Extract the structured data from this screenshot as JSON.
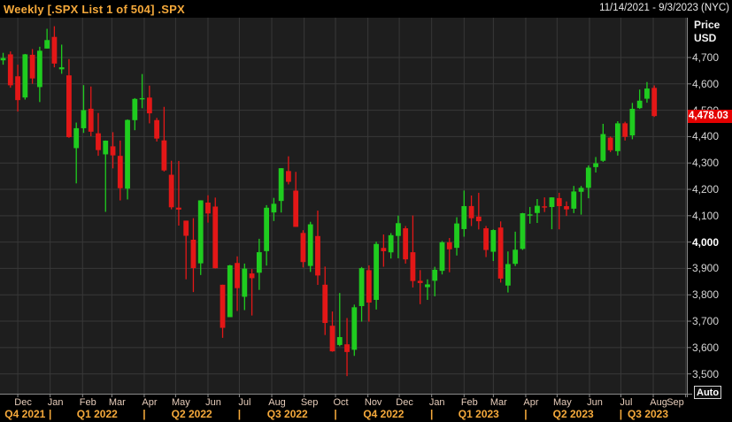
{
  "header": {
    "title": "Weekly [.SPX List 1 of 504] .SPX",
    "date_range": "11/14/2021 - 9/3/2023 (NYC)"
  },
  "price_axis": {
    "title_line1": "Price",
    "title_line2": "USD",
    "ticks": [
      4700,
      4600,
      4500,
      4400,
      4300,
      4200,
      4100,
      4000,
      3900,
      3800,
      3700,
      3600,
      3500
    ],
    "bold_tick": 4000,
    "last_price": "4,478.03",
    "auto_label": "Auto"
  },
  "time_axis": {
    "total_days": 658,
    "months": [
      {
        "label": "Dec",
        "day": 17
      },
      {
        "label": "Jan",
        "day": 48
      },
      {
        "label": "Feb",
        "day": 79
      },
      {
        "label": "Mar",
        "day": 107
      },
      {
        "label": "Apr",
        "day": 138
      },
      {
        "label": "May",
        "day": 168
      },
      {
        "label": "Jun",
        "day": 199
      },
      {
        "label": "Jul",
        "day": 229
      },
      {
        "label": "Aug",
        "day": 260
      },
      {
        "label": "Sep",
        "day": 291
      },
      {
        "label": "Oct",
        "day": 321
      },
      {
        "label": "Nov",
        "day": 352
      },
      {
        "label": "Dec",
        "day": 382
      },
      {
        "label": "Jan",
        "day": 413
      },
      {
        "label": "Feb",
        "day": 444
      },
      {
        "label": "Mar",
        "day": 472
      },
      {
        "label": "Apr",
        "day": 503
      },
      {
        "label": "May",
        "day": 533
      },
      {
        "label": "Jun",
        "day": 564
      },
      {
        "label": "Jul",
        "day": 594
      },
      {
        "label": "Aug",
        "day": 625
      },
      {
        "label": "Sep",
        "day": 656
      }
    ],
    "quarters": [
      {
        "label": "Q4 2021",
        "start": 0,
        "end": 48
      },
      {
        "label": "Q1 2022",
        "start": 48,
        "end": 138
      },
      {
        "label": "Q2 2022",
        "start": 138,
        "end": 229
      },
      {
        "label": "Q3 2022",
        "start": 229,
        "end": 321
      },
      {
        "label": "Q4 2022",
        "start": 321,
        "end": 413
      },
      {
        "label": "Q1 2023",
        "start": 413,
        "end": 503
      },
      {
        "label": "Q2 2023",
        "start": 503,
        "end": 594
      },
      {
        "label": "Q3 2023",
        "start": 594,
        "end": 658
      }
    ]
  },
  "colors": {
    "up_candle": "#1fcc1f",
    "down_candle": "#e31717",
    "badge_bg": "#e30000",
    "accent_amber": "#f5a93b",
    "month_label": "#e7cdbb",
    "plot_bg": "#1e1e1e",
    "gridline": "#383838",
    "axis_line": "#8a8a8a"
  },
  "chart_data": {
    "type": "candlestick",
    "symbol": ".SPX",
    "interval": "weekly",
    "title": "Weekly [.SPX List 1 of 504] .SPX",
    "ylabel": "Price USD",
    "last_close": 4478.03,
    "price_domain": [
      3425,
      4851
    ],
    "axis_ticks": [
      3500,
      3600,
      3700,
      3800,
      3900,
      4000,
      4100,
      4200,
      4300,
      4400,
      4500,
      4600,
      4700
    ],
    "x_range": [
      "2021-11-14",
      "2023-09-03"
    ],
    "grid": "monthly-vertical, 100pt-horizontal",
    "columns": [
      "week_ending",
      "open",
      "high",
      "low",
      "close"
    ],
    "candles": [
      [
        "2021-11-19",
        4689.3,
        4717.75,
        4672.78,
        4697.96
      ],
      [
        "2021-11-26",
        4712.0,
        4723.0,
        4585.43,
        4594.62
      ],
      [
        "2021-12-03",
        4628.75,
        4672.95,
        4495.12,
        4538.43
      ],
      [
        "2021-12-10",
        4548.37,
        4713.57,
        4540.51,
        4712.02
      ],
      [
        "2021-12-17",
        4710.3,
        4731.99,
        4600.22,
        4620.64
      ],
      [
        "2021-12-23",
        4587.9,
        4740.74,
        4531.1,
        4725.79
      ],
      [
        "2021-12-31",
        4733.99,
        4808.93,
        4733.99,
        4766.18
      ],
      [
        "2022-01-07",
        4778.14,
        4818.62,
        4662.74,
        4677.03
      ],
      [
        "2022-01-14",
        4655.34,
        4748.83,
        4638.27,
        4662.85
      ],
      [
        "2022-01-21",
        4632.24,
        4694.0,
        4395.34,
        4397.94
      ],
      [
        "2022-01-28",
        4356.32,
        4453.23,
        4222.62,
        4431.85
      ],
      [
        "2022-02-04",
        4431.79,
        4595.31,
        4414.02,
        4500.53
      ],
      [
        "2022-02-11",
        4505.75,
        4590.03,
        4401.41,
        4418.64
      ],
      [
        "2022-02-18",
        4412.61,
        4489.55,
        4327.22,
        4348.87
      ],
      [
        "2022-02-25",
        4332.74,
        4385.34,
        4114.65,
        4384.65
      ],
      [
        "2022-03-04",
        4363.14,
        4416.78,
        4279.54,
        4328.87
      ],
      [
        "2022-03-11",
        4327.01,
        4385.0,
        4157.87,
        4204.31
      ],
      [
        "2022-03-18",
        4202.75,
        4465.4,
        4161.72,
        4463.12
      ],
      [
        "2022-03-25",
        4462.4,
        4546.03,
        4424.3,
        4543.06
      ],
      [
        "2022-04-01",
        4541.09,
        4637.3,
        4507.57,
        4545.86
      ],
      [
        "2022-04-08",
        4547.97,
        4593.45,
        4450.3,
        4488.28
      ],
      [
        "2022-04-14",
        4462.64,
        4471.03,
        4381.34,
        4392.59
      ],
      [
        "2022-04-22",
        4385.63,
        4512.94,
        4267.62,
        4271.78
      ],
      [
        "2022-04-29",
        4255.34,
        4308.45,
        4124.28,
        4131.93
      ],
      [
        "2022-05-06",
        4130.61,
        4307.66,
        4062.51,
        4123.34
      ],
      [
        "2022-05-13",
        4081.27,
        4081.27,
        3858.87,
        4023.89
      ],
      [
        "2022-05-20",
        4008.91,
        4090.72,
        3810.32,
        3901.36
      ],
      [
        "2022-05-27",
        3919.42,
        4158.49,
        3875.13,
        4158.24
      ],
      [
        "2022-06-03",
        4149.78,
        4177.51,
        4073.85,
        4108.54
      ],
      [
        "2022-06-10",
        4134.72,
        4168.78,
        3900.16,
        3900.86
      ],
      [
        "2022-06-17",
        3838.15,
        3838.48,
        3636.87,
        3674.84
      ],
      [
        "2022-06-24",
        3715.31,
        3913.65,
        3715.31,
        3911.74
      ],
      [
        "2022-07-01",
        3920.76,
        3945.86,
        3738.67,
        3825.33
      ],
      [
        "2022-07-08",
        3792.61,
        3918.5,
        3742.06,
        3899.38
      ],
      [
        "2022-07-15",
        3880.94,
        3897.58,
        3721.56,
        3863.16
      ],
      [
        "2022-07-22",
        3883.79,
        4012.44,
        3818.63,
        3961.63
      ],
      [
        "2022-07-29",
        3965.72,
        4140.15,
        3910.74,
        4130.29
      ],
      [
        "2022-08-05",
        4112.38,
        4167.66,
        4079.81,
        4145.19
      ],
      [
        "2022-08-12",
        4155.93,
        4280.47,
        4112.09,
        4280.15
      ],
      [
        "2022-08-19",
        4269.37,
        4325.28,
        4218.7,
        4228.48
      ],
      [
        "2022-08-26",
        4195.08,
        4266.31,
        4057.66,
        4057.66
      ],
      [
        "2022-09-02",
        4034.58,
        4044.98,
        3903.65,
        3924.26
      ],
      [
        "2022-09-09",
        3909.43,
        4076.81,
        3886.75,
        4067.36
      ],
      [
        "2022-09-16",
        4022.94,
        4119.28,
        3837.55,
        3873.33
      ],
      [
        "2022-09-23",
        3838.33,
        3907.07,
        3647.47,
        3693.23
      ],
      [
        "2022-09-30",
        3682.72,
        3736.74,
        3584.13,
        3585.62
      ],
      [
        "2022-10-07",
        3609.78,
        3806.91,
        3604.93,
        3639.66
      ],
      [
        "2022-10-14",
        3612.25,
        3712.0,
        3491.58,
        3583.07
      ],
      [
        "2022-10-21",
        3591.61,
        3762.79,
        3568.45,
        3752.75
      ],
      [
        "2022-10-28",
        3757.21,
        3905.42,
        3698.15,
        3901.06
      ],
      [
        "2022-11-04",
        3893.48,
        3911.79,
        3698.15,
        3770.55
      ],
      [
        "2022-11-11",
        3780.78,
        4001.48,
        3744.22,
        3992.93
      ],
      [
        "2022-11-18",
        3977.84,
        4028.84,
        3906.54,
        3965.34
      ],
      [
        "2022-11-25",
        3961.02,
        4034.02,
        3937.65,
        4026.12
      ],
      [
        "2022-12-02",
        4023.34,
        4100.51,
        3938.58,
        4071.7
      ],
      [
        "2022-12-09",
        4052.35,
        4060.79,
        3918.39,
        3934.38
      ],
      [
        "2022-12-16",
        3961.51,
        4100.96,
        3827.91,
        3852.36
      ],
      [
        "2022-12-23",
        3853.06,
        3893.75,
        3764.49,
        3844.82
      ],
      [
        "2022-12-30",
        3829.06,
        3858.64,
        3780.78,
        3839.5
      ],
      [
        "2023-01-06",
        3853.29,
        3906.19,
        3794.33,
        3895.08
      ],
      [
        "2023-01-13",
        3890.89,
        4003.95,
        3877.29,
        3999.09
      ],
      [
        "2023-01-20",
        3999.28,
        4015.39,
        3885.54,
        3972.61
      ],
      [
        "2023-01-27",
        3978.14,
        4094.21,
        3949.06,
        4070.56
      ],
      [
        "2023-02-03",
        4049.27,
        4195.44,
        4020.44,
        4136.48
      ],
      [
        "2023-02-10",
        4136.69,
        4176.54,
        4060.79,
        4090.46
      ],
      [
        "2023-02-17",
        4096.62,
        4186.92,
        4047.95,
        4079.09
      ],
      [
        "2023-02-24",
        4052.35,
        4061.01,
        3943.04,
        3970.04
      ],
      [
        "2023-03-03",
        3963.34,
        4048.29,
        3928.16,
        4045.64
      ],
      [
        "2023-03-10",
        4055.15,
        4078.49,
        3846.32,
        3861.59
      ],
      [
        "2023-03-17",
        3835.12,
        3964.46,
        3808.86,
        3916.64
      ],
      [
        "2023-03-24",
        3917.47,
        4039.49,
        3909.16,
        3970.99
      ],
      [
        "2023-03-31",
        3974.13,
        4110.75,
        3970.19,
        4109.31
      ],
      [
        "2023-04-06",
        4102.2,
        4133.13,
        4069.84,
        4105.02
      ],
      [
        "2023-04-14",
        4110.29,
        4163.19,
        4072.55,
        4137.64
      ],
      [
        "2023-04-21",
        4135.53,
        4169.48,
        4113.86,
        4133.52
      ],
      [
        "2023-04-28",
        4132.91,
        4170.06,
        4048.7,
        4169.48
      ],
      [
        "2023-05-05",
        4166.79,
        4186.92,
        4048.28,
        4136.25
      ],
      [
        "2023-05-12",
        4136.2,
        4154.28,
        4098.92,
        4124.08
      ],
      [
        "2023-05-19",
        4126.73,
        4212.91,
        4109.86,
        4191.98
      ],
      [
        "2023-05-26",
        4190.78,
        4212.87,
        4103.98,
        4205.45
      ],
      [
        "2023-06-02",
        4205.84,
        4290.67,
        4166.15,
        4282.37
      ],
      [
        "2023-06-09",
        4284.37,
        4322.62,
        4263.96,
        4298.86
      ],
      [
        "2023-06-16",
        4308.32,
        4448.47,
        4304.27,
        4409.59
      ],
      [
        "2023-06-23",
        4396.11,
        4400.15,
        4341.34,
        4348.33
      ],
      [
        "2023-06-30",
        4345.02,
        4458.48,
        4328.08,
        4450.38
      ],
      [
        "2023-07-07",
        4450.48,
        4456.46,
        4385.05,
        4398.95
      ],
      [
        "2023-07-14",
        4404.54,
        4527.76,
        4389.92,
        4505.42
      ],
      [
        "2023-07-21",
        4508.13,
        4578.43,
        4504.9,
        4536.34
      ],
      [
        "2023-07-28",
        4543.72,
        4607.07,
        4528.56,
        4582.23
      ],
      [
        "2023-08-04",
        4584.82,
        4594.22,
        4474.55,
        4478.03
      ]
    ]
  }
}
